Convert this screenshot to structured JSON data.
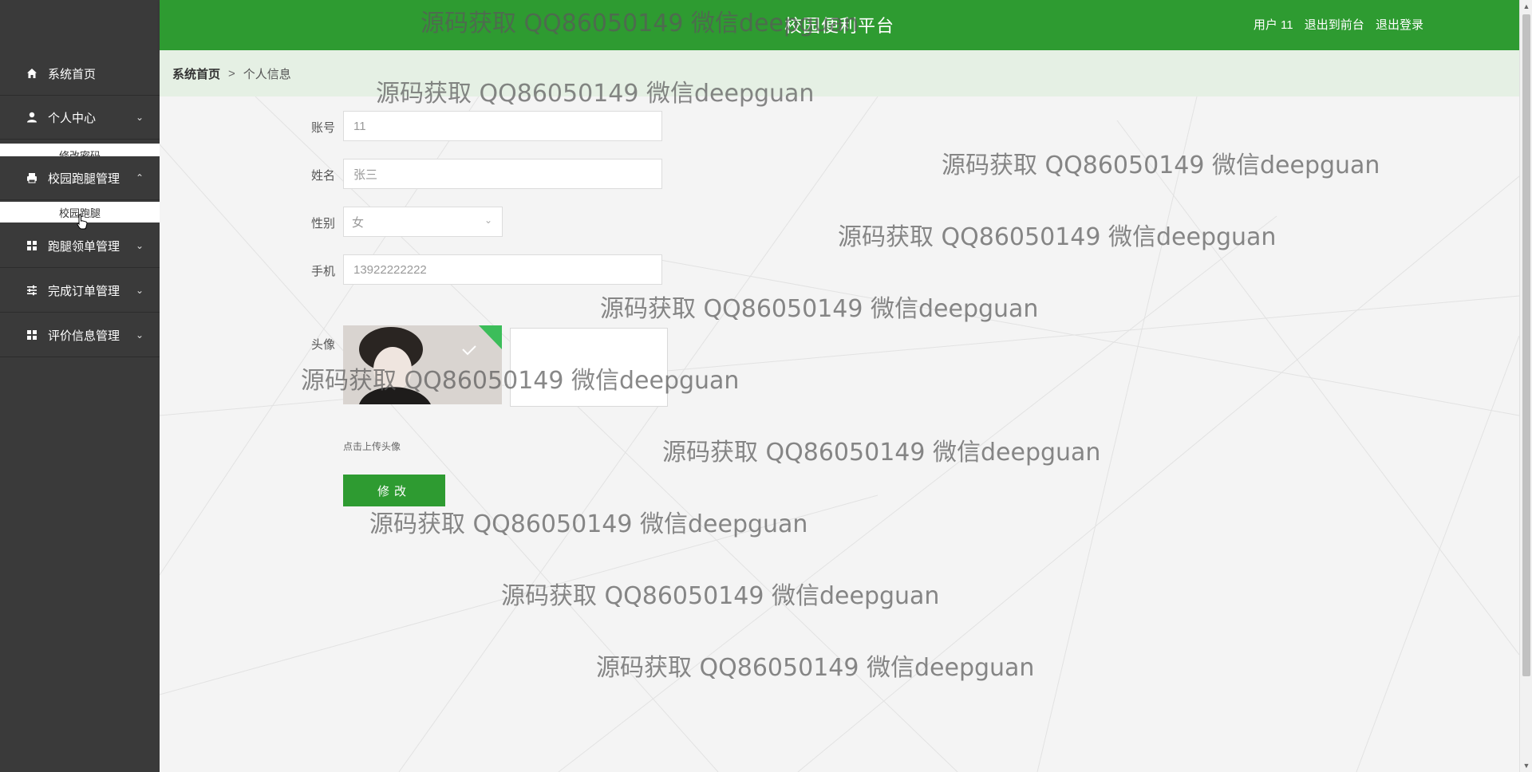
{
  "header": {
    "title": "校园便利平台",
    "username": "用户 11",
    "back_to_front": "退出到前台",
    "logout": "退出登录"
  },
  "sidebar": {
    "items": [
      {
        "label": "系统首页",
        "icon": "home-icon"
      },
      {
        "label": "个人中心",
        "icon": "user-icon",
        "submenu": "修改密码"
      },
      {
        "label": "校园跑腿管理",
        "icon": "printer-icon",
        "submenu": "校园跑腿"
      },
      {
        "label": "跑腿领单管理",
        "icon": "grid-icon"
      },
      {
        "label": "完成订单管理",
        "icon": "sliders-icon"
      },
      {
        "label": "评价信息管理",
        "icon": "grid-icon"
      }
    ]
  },
  "breadcrumb": {
    "home": "系统首页",
    "separator": ">",
    "current": "个人信息"
  },
  "form": {
    "account_label": "账号",
    "account_value": "11",
    "name_label": "姓名",
    "name_value": "张三",
    "gender_label": "性别",
    "gender_value": "女",
    "phone_label": "手机",
    "phone_value": "13922222222",
    "avatar_label": "头像",
    "upload_hint": "点击上传头像",
    "submit_label": "修改"
  },
  "watermark_text": "源码获取 QQ86050149 微信deepguan",
  "colors": {
    "primary_green": "#2e9b31",
    "sidebar_bg": "#3a3a3a",
    "breadcrumb_bg": "#e5f0e4"
  }
}
